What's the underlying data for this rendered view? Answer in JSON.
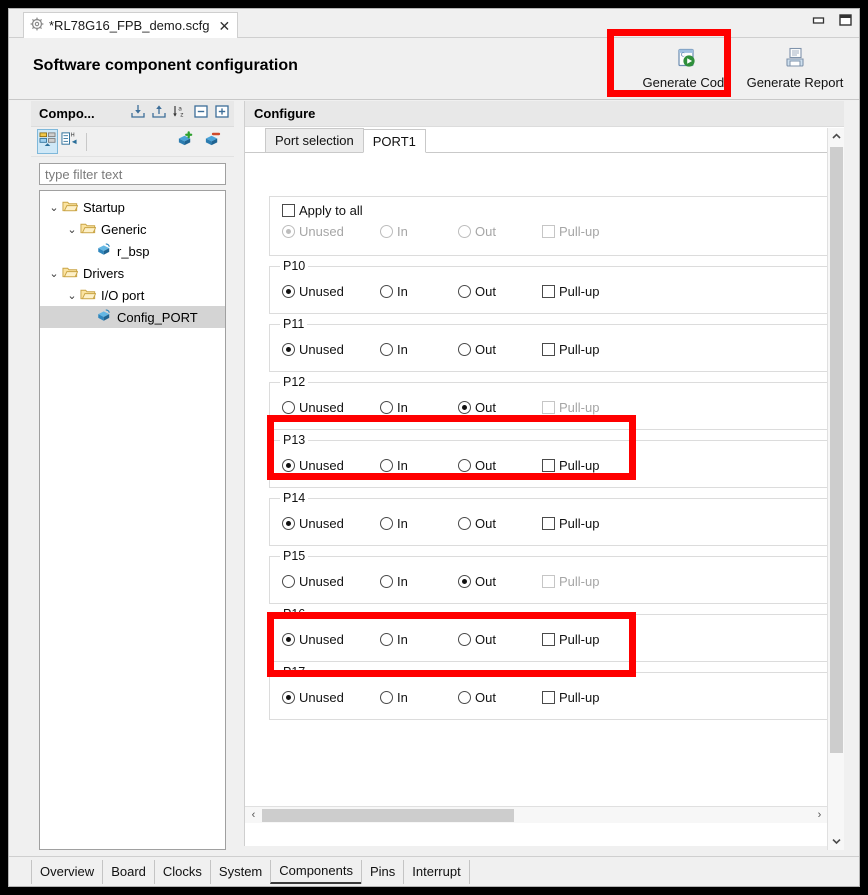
{
  "window": {
    "editor_tab": {
      "icon": "gear-icon",
      "title": "*RL78G16_FPB_demo.scfg",
      "close": "✕"
    },
    "controls": {
      "minimize": "minimize-icon",
      "maximize": "maximize-icon"
    }
  },
  "header": {
    "title": "Software component configuration",
    "buttons": [
      {
        "label": "Generate Code",
        "icon": "generate-code-icon"
      },
      {
        "label": "Generate Report",
        "icon": "generate-report-icon"
      }
    ]
  },
  "sidebar": {
    "title": "Compo...",
    "header_icons": [
      "import-icon",
      "export-icon",
      "sort-az-icon",
      "collapse-all-icon",
      "expand-all-icon"
    ],
    "toolbar_icons": [
      "component-view-icon",
      "hardware-view-icon",
      "add-component-icon",
      "remove-component-icon"
    ],
    "filter_placeholder": "type filter text",
    "filter_value": "",
    "tree": [
      {
        "label": "Startup",
        "depth": 0,
        "chevron": "⌄",
        "icon": "folder-icon",
        "selected": false
      },
      {
        "label": "Generic",
        "depth": 1,
        "chevron": "⌄",
        "icon": "folder-icon",
        "selected": false
      },
      {
        "label": "r_bsp",
        "depth": 2,
        "chevron": "",
        "icon": "component-icon",
        "selected": false
      },
      {
        "label": "Drivers",
        "depth": 0,
        "chevron": "⌄",
        "icon": "folder-icon",
        "selected": false
      },
      {
        "label": "I/O port",
        "depth": 1,
        "chevron": "⌄",
        "icon": "folder-icon",
        "selected": false
      },
      {
        "label": "Config_PORT",
        "depth": 2,
        "chevron": "",
        "icon": "component-icon",
        "selected": true
      }
    ]
  },
  "configure": {
    "title": "Configure",
    "tabs": [
      {
        "label": "Port selection",
        "active": false
      },
      {
        "label": "PORT1",
        "active": true
      }
    ],
    "apply_to_all": {
      "label": "Apply to all",
      "checked": false,
      "disabled": false,
      "options": [
        {
          "label": "Unused",
          "selected": true,
          "disabled": true
        },
        {
          "label": "In",
          "selected": false,
          "disabled": true
        },
        {
          "label": "Out",
          "selected": false,
          "disabled": true
        }
      ],
      "pullup": {
        "label": "Pull-up",
        "checked": false,
        "disabled": true
      }
    },
    "ports": [
      {
        "name": "P10",
        "highlighted": false,
        "options": [
          {
            "label": "Unused",
            "selected": true,
            "disabled": false
          },
          {
            "label": "In",
            "selected": false,
            "disabled": false
          },
          {
            "label": "Out",
            "selected": false,
            "disabled": false
          }
        ],
        "pullup": {
          "label": "Pull-up",
          "checked": false,
          "disabled": false
        }
      },
      {
        "name": "P11",
        "highlighted": false,
        "options": [
          {
            "label": "Unused",
            "selected": true,
            "disabled": false
          },
          {
            "label": "In",
            "selected": false,
            "disabled": false
          },
          {
            "label": "Out",
            "selected": false,
            "disabled": false
          }
        ],
        "pullup": {
          "label": "Pull-up",
          "checked": false,
          "disabled": false
        }
      },
      {
        "name": "P12",
        "highlighted": true,
        "options": [
          {
            "label": "Unused",
            "selected": false,
            "disabled": false
          },
          {
            "label": "In",
            "selected": false,
            "disabled": false
          },
          {
            "label": "Out",
            "selected": true,
            "disabled": false
          }
        ],
        "pullup": {
          "label": "Pull-up",
          "checked": false,
          "disabled": true
        }
      },
      {
        "name": "P13",
        "highlighted": false,
        "options": [
          {
            "label": "Unused",
            "selected": true,
            "disabled": false
          },
          {
            "label": "In",
            "selected": false,
            "disabled": false
          },
          {
            "label": "Out",
            "selected": false,
            "disabled": false
          }
        ],
        "pullup": {
          "label": "Pull-up",
          "checked": false,
          "disabled": false
        }
      },
      {
        "name": "P14",
        "highlighted": false,
        "options": [
          {
            "label": "Unused",
            "selected": true,
            "disabled": false
          },
          {
            "label": "In",
            "selected": false,
            "disabled": false
          },
          {
            "label": "Out",
            "selected": false,
            "disabled": false
          }
        ],
        "pullup": {
          "label": "Pull-up",
          "checked": false,
          "disabled": false
        }
      },
      {
        "name": "P15",
        "highlighted": true,
        "options": [
          {
            "label": "Unused",
            "selected": false,
            "disabled": false
          },
          {
            "label": "In",
            "selected": false,
            "disabled": false
          },
          {
            "label": "Out",
            "selected": true,
            "disabled": false
          }
        ],
        "pullup": {
          "label": "Pull-up",
          "checked": false,
          "disabled": true
        }
      },
      {
        "name": "P16",
        "highlighted": false,
        "options": [
          {
            "label": "Unused",
            "selected": true,
            "disabled": false
          },
          {
            "label": "In",
            "selected": false,
            "disabled": false
          },
          {
            "label": "Out",
            "selected": false,
            "disabled": false
          }
        ],
        "pullup": {
          "label": "Pull-up",
          "checked": false,
          "disabled": false
        }
      },
      {
        "name": "P17",
        "highlighted": false,
        "options": [
          {
            "label": "Unused",
            "selected": true,
            "disabled": false
          },
          {
            "label": "In",
            "selected": false,
            "disabled": false
          },
          {
            "label": "Out",
            "selected": false,
            "disabled": false
          }
        ],
        "pullup": {
          "label": "Pull-up",
          "checked": false,
          "disabled": false
        }
      }
    ],
    "scrollbars": {
      "vertical": {
        "up": "▲",
        "down": "▼"
      },
      "horizontal": {
        "left": "‹",
        "right": "›"
      }
    }
  },
  "bottom_tabs": [
    {
      "label": "Overview",
      "active": false
    },
    {
      "label": "Board",
      "active": false
    },
    {
      "label": "Clocks",
      "active": false
    },
    {
      "label": "System",
      "active": false
    },
    {
      "label": "Components",
      "active": true
    },
    {
      "label": "Pins",
      "active": false
    },
    {
      "label": "Interrupt",
      "active": false
    }
  ],
  "colors": {
    "highlight": "#ff0000",
    "selection": "#d4d4d4",
    "toggle_active": "#cfe8f7"
  }
}
